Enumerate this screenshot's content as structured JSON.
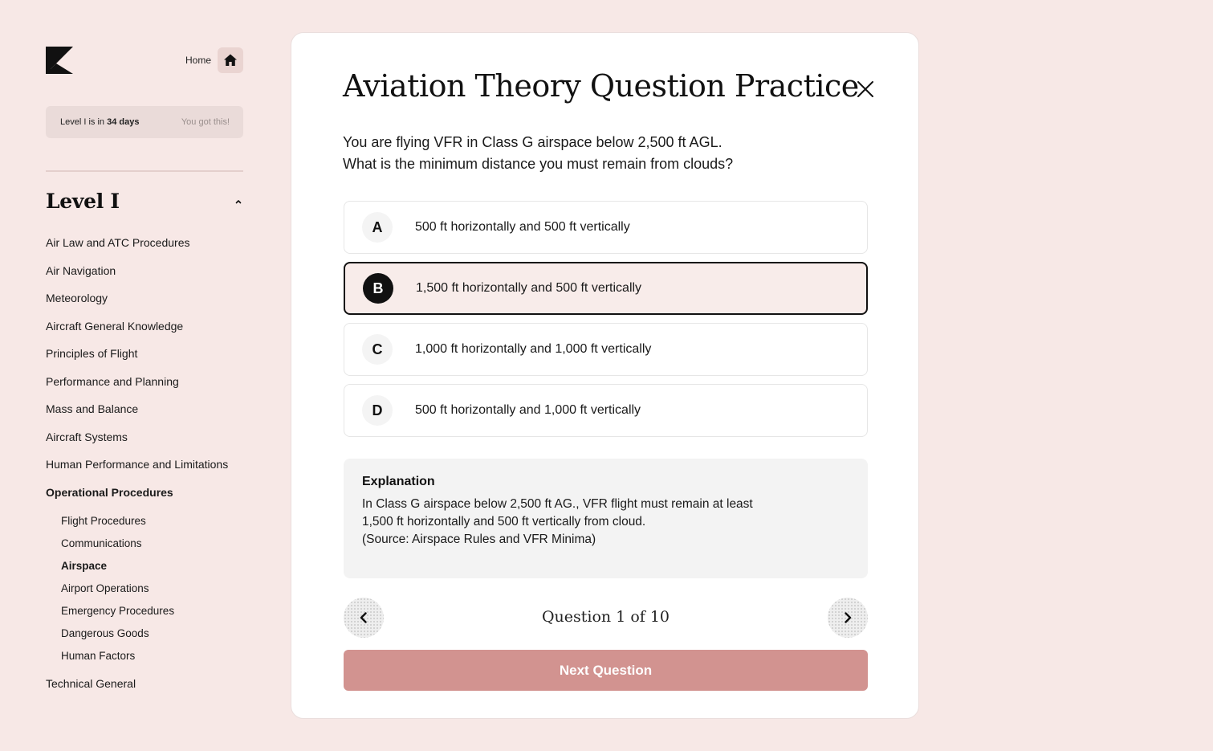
{
  "sidebar": {
    "logo_icon": "k-logo-icon",
    "home_label": "Home",
    "home_icon": "home-icon",
    "countdown_prefix": "Level I is in ",
    "countdown_days": "34 days",
    "countdown_message": "You got this!",
    "level_title": "Level I",
    "level_expanded": true,
    "topics": [
      {
        "label": "Air Law and ATC Procedures"
      },
      {
        "label": "Air Navigation"
      },
      {
        "label": "Meteorology"
      },
      {
        "label": "Aircraft General Knowledge"
      },
      {
        "label": "Principles of Flight"
      },
      {
        "label": "Performance and Planning"
      },
      {
        "label": "Mass and Balance"
      },
      {
        "label": "Aircraft Systems"
      },
      {
        "label": "Human Performance and Limitations"
      },
      {
        "label": "Operational Procedures",
        "active": true
      }
    ],
    "subtopics": [
      {
        "label": "Flight Procedures"
      },
      {
        "label": "Communications"
      },
      {
        "label": "Airspace",
        "active": true
      },
      {
        "label": "Airport Operations"
      },
      {
        "label": "Emergency Procedures"
      },
      {
        "label": "Dangerous Goods"
      },
      {
        "label": "Human Factors"
      }
    ],
    "after_topics": [
      {
        "label": "Technical General"
      }
    ]
  },
  "quiz": {
    "title": "Aviation Theory Question Practice",
    "question_line1": "You are flying VFR in Class G airspace below 2,500 ft AGL.",
    "question_line2": "What is the minimum distance you must remain from clouds?",
    "selected": "B",
    "options": [
      {
        "letter": "A",
        "text": "500 ft horizontally and 500 ft vertically"
      },
      {
        "letter": "B",
        "text": "1,500 ft horizontally and 500 ft vertically"
      },
      {
        "letter": "C",
        "text": "1,000 ft horizontally and 1,000 ft vertically"
      },
      {
        "letter": "D",
        "text": "500 ft horizontally and 1,000 ft vertically"
      }
    ],
    "explanation_title": "Explanation",
    "explanation_line1": "In Class G airspace below 2,500 ft AG., VFR flight must remain at least",
    "explanation_line2": "1,500 ft horizontally and 500 ft vertically from cloud.",
    "explanation_line3": "(Source: Airspace Rules and VFR Minima)",
    "counter": "Question 1 of 10",
    "next_label": "Next Question"
  },
  "colors": {
    "page_bg": "#f7e8e6",
    "accent_button": "#d29390",
    "selected_option_bg": "#f8ecea"
  }
}
